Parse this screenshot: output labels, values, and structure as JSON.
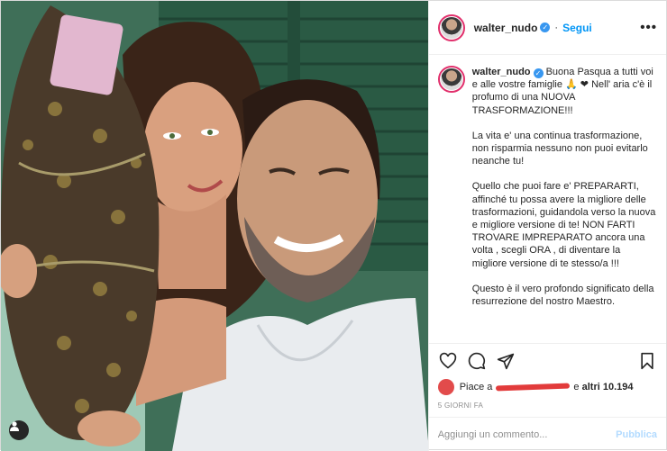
{
  "post": {
    "username": "walter_nudo",
    "follow_label": "Segui",
    "more_label": "•••",
    "caption": {
      "username": "walter_nudo",
      "paragraphs": [
        "Buona Pasqua a tutti voi e alle vostre famiglie 🙏 ❤ Nell' aria c'è il profumo di una NUOVA TRASFORMAZIONE!!!",
        "La vita e' una continua trasformazione, non risparmia nessuno non puoi evitarlo neanche tu!",
        "Quello che puoi fare e' PREPARARTI, affinché tu possa avere la migliore delle trasformazioni, guidandola verso la nuova e migliore versione di te! NON FARTI TROVARE IMPREPARATO ancora una volta , scegli ORA , di diventare la migliore versione di te stesso/a !!!",
        "Questo è il vero profondo significato della resurrezione del nostro Maestro."
      ]
    },
    "likes": {
      "prefix": "Piace a",
      "suffix": "e",
      "count_text": "altri 10.194"
    },
    "timestamp": "5 GIORNI FA",
    "comment": {
      "placeholder": "Aggiungi un commento...",
      "publish_label": "Pubblica"
    },
    "icons": {
      "like": "heart-icon",
      "comment": "comment-icon",
      "share": "share-icon",
      "save": "bookmark-icon",
      "tag": "user-tag-icon"
    },
    "colors": {
      "follow": "#0095f6",
      "verified": "#3897f0",
      "redaction": "#e23b3b"
    }
  }
}
